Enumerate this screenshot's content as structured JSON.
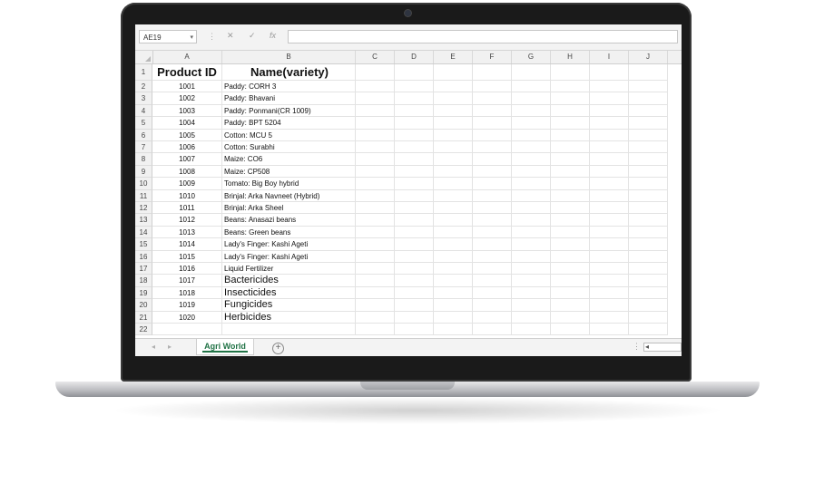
{
  "formula_bar": {
    "name_box": "AE19",
    "cancel_icon": "✕",
    "enter_icon": "✓",
    "function_icon": "fx"
  },
  "columns": [
    "A",
    "B",
    "C",
    "D",
    "E",
    "F",
    "G",
    "H",
    "I",
    "J"
  ],
  "header_row": {
    "row": "1",
    "a": "Product ID",
    "b": "Name(variety)"
  },
  "rows": [
    {
      "row": "2",
      "a": "1001",
      "b": "Paddy: CORH 3"
    },
    {
      "row": "3",
      "a": "1002",
      "b": "Paddy: Bhavani"
    },
    {
      "row": "4",
      "a": "1003",
      "b": "Paddy: Ponmani(CR 1009)"
    },
    {
      "row": "5",
      "a": "1004",
      "b": "Paddy: BPT 5204"
    },
    {
      "row": "6",
      "a": "1005",
      "b": "Cotton: MCU 5"
    },
    {
      "row": "7",
      "a": "1006",
      "b": "Cotton: Surabhi"
    },
    {
      "row": "8",
      "a": "1007",
      "b": "Maize: CO6"
    },
    {
      "row": "9",
      "a": "1008",
      "b": "Maize: CP508"
    },
    {
      "row": "10",
      "a": "1009",
      "b": "Tomato: Big Boy hybrid"
    },
    {
      "row": "11",
      "a": "1010",
      "b": "Brinjal: Arka Navneet (Hybrid)"
    },
    {
      "row": "12",
      "a": "1011",
      "b": "Brinjal:  Arka Sheel"
    },
    {
      "row": "13",
      "a": "1012",
      "b": "Beans: Anasazi beans"
    },
    {
      "row": "14",
      "a": "1013",
      "b": "Beans: Green beans"
    },
    {
      "row": "15",
      "a": "1014",
      "b": "Lady's Finger: Kashi Ageti"
    },
    {
      "row": "16",
      "a": "1015",
      "b": "Lady's Finger: Kashi Ageti"
    },
    {
      "row": "17",
      "a": "1016",
      "b": "Liquid Fertilizer"
    },
    {
      "row": "18",
      "a": "1017",
      "b": "Bactericides"
    },
    {
      "row": "19",
      "a": "1018",
      "b": "Insecticides"
    },
    {
      "row": "20",
      "a": "1019",
      "b": "Fungicides"
    },
    {
      "row": "21",
      "a": "1020",
      "b": "Herbicides"
    },
    {
      "row": "22",
      "a": "",
      "b": ""
    }
  ],
  "sheet_tabs": [
    "Agri World"
  ],
  "accent_color": "#217346"
}
